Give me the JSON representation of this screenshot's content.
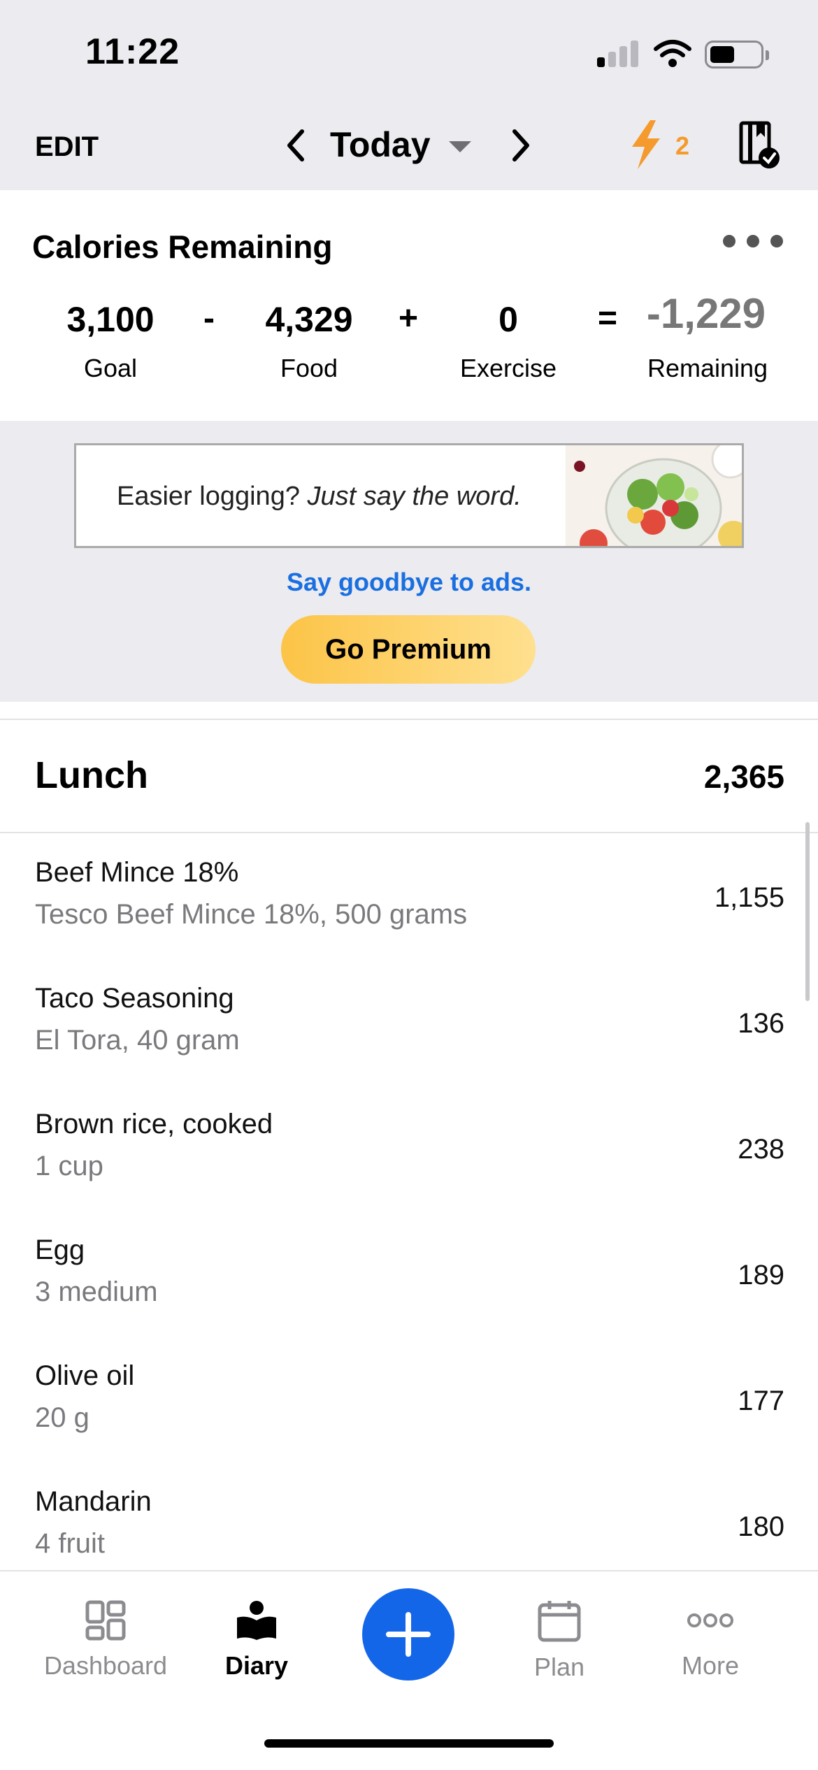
{
  "status_bar": {
    "time": "11:22"
  },
  "header": {
    "edit_label": "EDIT",
    "date_label": "Today",
    "streak_count": "2",
    "accent_color": "#f59a2c"
  },
  "calories": {
    "title": "Calories Remaining",
    "goal": {
      "value": "3,100",
      "label": "Goal"
    },
    "op_minus": "-",
    "food": {
      "value": "4,329",
      "label": "Food"
    },
    "op_plus": "+",
    "exercise": {
      "value": "0",
      "label": "Exercise"
    },
    "op_equals": "=",
    "remaining": {
      "value": "-1,229",
      "label": "Remaining"
    }
  },
  "ad": {
    "text_plain": "Easier logging? ",
    "text_italic": "Just say the word.",
    "link_text": "Say goodbye to ads.",
    "premium_button": "Go Premium",
    "link_color": "#1a6fe0"
  },
  "meal": {
    "title": "Lunch",
    "total": "2,365",
    "items": [
      {
        "name": "Beef Mince 18%",
        "detail": "Tesco Beef Mince 18%, 500 grams",
        "calories": "1,155"
      },
      {
        "name": "Taco Seasoning",
        "detail": "El Tora, 40 gram",
        "calories": "136"
      },
      {
        "name": "Brown rice, cooked",
        "detail": "1 cup",
        "calories": "238"
      },
      {
        "name": "Egg",
        "detail": "3 medium",
        "calories": "189"
      },
      {
        "name": "Olive oil",
        "detail": "20 g",
        "calories": "177"
      },
      {
        "name": "Mandarin",
        "detail": "4 fruit",
        "calories": "180"
      }
    ]
  },
  "tabbar": {
    "dashboard": "Dashboard",
    "diary": "Diary",
    "plan": "Plan",
    "more": "More",
    "fab_color": "#1466e8"
  }
}
